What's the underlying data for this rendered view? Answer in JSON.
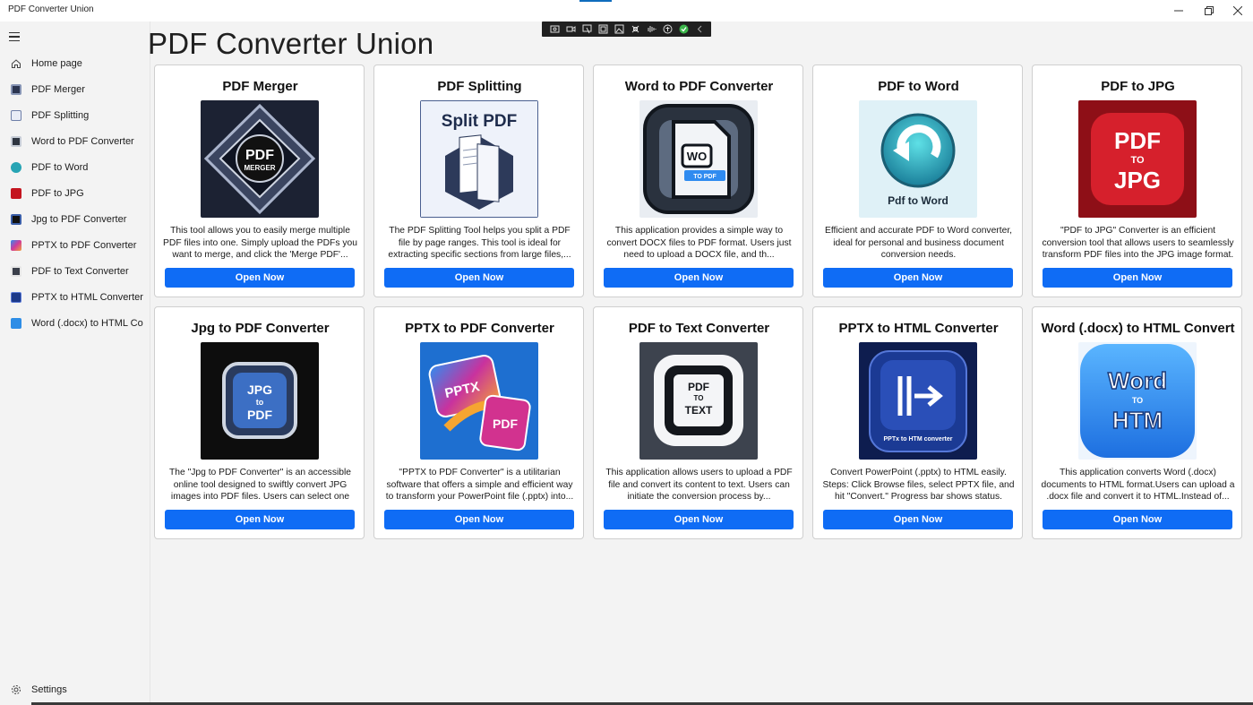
{
  "window": {
    "title": "PDF Converter Union",
    "min_icon": "minimize-icon",
    "max_icon": "restore-icon",
    "close_icon": "close-icon"
  },
  "capture_toolbar": {
    "icons": [
      "screenshot-icon",
      "video-icon",
      "pointer-icon",
      "region-icon",
      "image-icon",
      "touch-icon",
      "audio-icon",
      "accessibility-icon",
      "check-icon",
      "collapse-icon"
    ]
  },
  "sidebar": {
    "items": [
      {
        "label": "Home page",
        "icon": "home-icon",
        "color": "#444444"
      },
      {
        "label": "PDF Merger",
        "icon": "pdf-merger-icon",
        "color": "#2b3550"
      },
      {
        "label": "PDF Splitting",
        "icon": "pdf-splitting-icon",
        "color": "#6e7fa8"
      },
      {
        "label": "Word to PDF Converter",
        "icon": "word-to-pdf-icon",
        "color": "#2e3540"
      },
      {
        "label": "PDF to Word",
        "icon": "pdf-to-word-icon",
        "color": "#27a4b4"
      },
      {
        "label": "PDF to JPG",
        "icon": "pdf-to-jpg-icon",
        "color": "#c4151f"
      },
      {
        "label": "Jpg to PDF Converter",
        "icon": "jpg-to-pdf-icon",
        "color": "#1f2d4a"
      },
      {
        "label": "PPTX to PDF Converter",
        "icon": "pptx-to-pdf-icon",
        "color": "#7b3fb0"
      },
      {
        "label": "PDF to Text Converter",
        "icon": "pdf-to-text-icon",
        "color": "#3a3f4a"
      },
      {
        "label": "PPTX to HTML Converter",
        "icon": "pptx-to-html-icon",
        "color": "#1d3a8a"
      },
      {
        "label": "Word (.docx) to HTML Co",
        "icon": "word-to-html-icon",
        "color": "#2e8de6"
      }
    ],
    "settings_label": "Settings"
  },
  "main": {
    "title": "PDF Converter Union",
    "cards": [
      {
        "title": "PDF Merger",
        "image_text": [
          "PDF",
          "MERGER"
        ],
        "desc": "This tool allows you to easily merge multiple PDF files into one. Simply upload the PDFs you want to merge, and click the 'Merge PDF'...",
        "button": "Open Now"
      },
      {
        "title": "PDF Splitting",
        "image_text": [
          "Split PDF"
        ],
        "desc": "The PDF Splitting Tool helps you split a PDF file by page ranges. This tool is ideal for extracting specific sections from large files,...",
        "button": "Open Now"
      },
      {
        "title": "Word to PDF Converter",
        "image_text": [
          "WO",
          "TO PDF"
        ],
        "desc": "This application provides a simple way to convert DOCX files to PDF format. Users just need to upload a DOCX file, and th...",
        "button": "Open Now"
      },
      {
        "title": "PDF to Word",
        "image_text": [
          "Pdf to Word"
        ],
        "desc": "Efficient and accurate PDF to Word converter, ideal for personal and business document conversion needs.",
        "button": "Open Now"
      },
      {
        "title": "PDF to JPG",
        "image_text": [
          "PDF",
          "TO",
          "JPG"
        ],
        "desc": "\"PDF to JPG\" Converter is an efficient conversion tool that allows users to seamlessly transform PDF files into the JPG image format.",
        "button": "Open Now"
      },
      {
        "title": "Jpg to PDF Converter",
        "image_text": [
          "JPG",
          "to",
          "PDF"
        ],
        "desc": "The \"Jpg to PDF Converter\" is an accessible online tool designed to swiftly convert JPG images into PDF files. Users can select one or...",
        "button": "Open Now"
      },
      {
        "title": "PPTX to PDF Converter",
        "image_text": [
          "PPTX",
          "PDF"
        ],
        "desc": "\"PPTX to PDF Converter\" is a utilitarian software that offers a simple and efficient way to transform your PowerPoint file (.pptx) into...",
        "button": "Open Now"
      },
      {
        "title": "PDF to Text Converter",
        "image_text": [
          "PDF",
          "TO",
          "TEXT"
        ],
        "desc": "This application allows users to upload a PDF file and convert its content to text. Users can initiate the conversion process by...",
        "button": "Open Now"
      },
      {
        "title": "PPTX to HTML Converter",
        "image_text": [
          "PPTx to HTM converter"
        ],
        "desc": "Convert PowerPoint (.pptx) to HTML easily. Steps: Click Browse files, select PPTX file, and hit \"Convert.\" Progress bar shows status. Onc...",
        "button": "Open Now"
      },
      {
        "title": "Word (.docx) to HTML Convert",
        "image_text": [
          "Word",
          "TO",
          "HTM"
        ],
        "desc": "This application converts Word (.docx) documents to HTML format.Users can upload a .docx file and convert it to HTML.Instead of...",
        "button": "Open Now"
      }
    ]
  }
}
